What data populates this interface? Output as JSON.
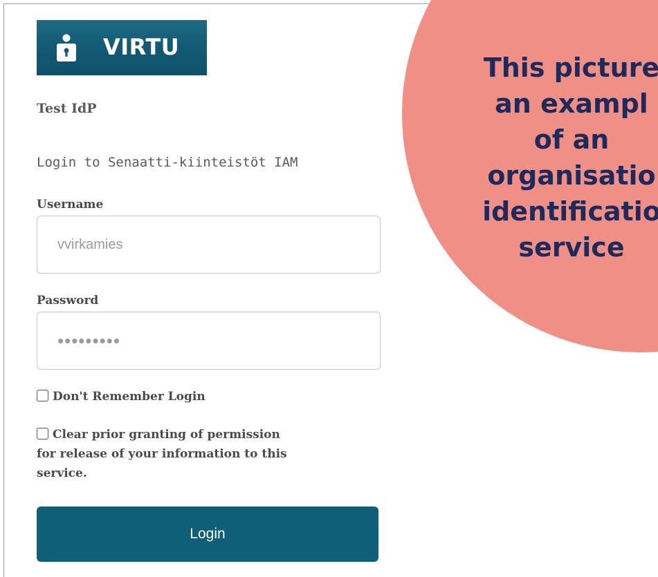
{
  "logo": {
    "text": "VIRTU",
    "icon": "person-keyhole-icon",
    "color": "#145b75"
  },
  "idp_title": "Test IdP",
  "login_subtitle": "Login to Senaatti-kiinteistöt IAM",
  "form": {
    "username": {
      "label": "Username",
      "placeholder": "vvirkamies",
      "value": ""
    },
    "password": {
      "label": "Password",
      "value": "•••••••••"
    },
    "checkboxes": [
      {
        "label": "Don't Remember Login",
        "checked": false
      },
      {
        "label": "Clear prior granting of permission for release of your information to this service.",
        "checked": false
      }
    ],
    "login_button": "Login"
  },
  "callout": {
    "lines": [
      "This picture",
      "an exampl",
      "of an",
      "organisatio",
      "identificatio",
      "service"
    ],
    "color": "#f08f86",
    "text_color": "#1f2a5a"
  },
  "colors": {
    "accent": "#0e6079",
    "text": "#4a4a4a"
  }
}
